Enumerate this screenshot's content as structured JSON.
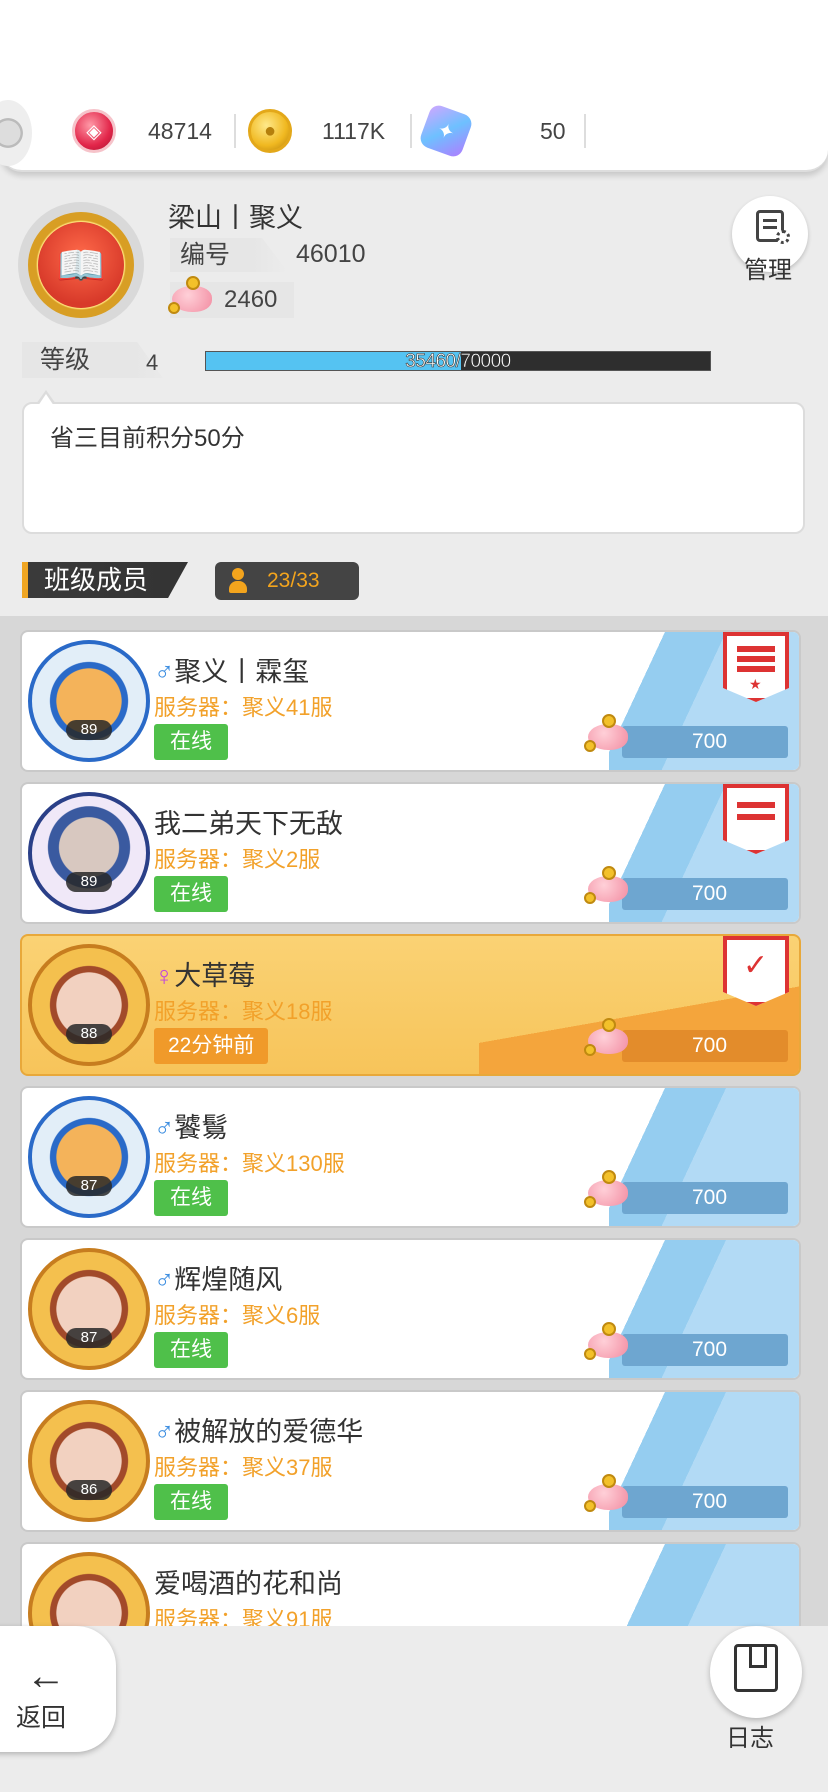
{
  "currencies": [
    {
      "icon": "ruby-icon",
      "value": "48714"
    },
    {
      "icon": "gold-coin-icon",
      "value": "1117K"
    },
    {
      "icon": "crystal-icon",
      "value": "50"
    }
  ],
  "guild": {
    "name": "梁山丨聚义",
    "id_label": "编号",
    "id_value": "46010",
    "funds": "2460",
    "level_label": "等级",
    "level": "4",
    "xp_text": "35460/70000",
    "xp_fraction": 0.5066,
    "manage_label": "管理",
    "notice": "省三目前积分50分"
  },
  "members_section": {
    "title": "班级成员",
    "count": "23/33"
  },
  "members": [
    {
      "gender": "♂",
      "name": "聚义丨霖玺",
      "server": "服务器：聚义41服",
      "level": "89",
      "status": "在线",
      "contribution": "700",
      "rank_icon": "rank-flag-leader-icon"
    },
    {
      "gender": "",
      "name": "我二弟天下无敌",
      "server": "服务器：聚义2服",
      "level": "89",
      "status": "在线",
      "contribution": "700",
      "rank_icon": "rank-flag-vice-icon"
    },
    {
      "gender": "♀",
      "name": "大草莓",
      "server": "服务器：聚义18服",
      "level": "88",
      "status": "22分钟前",
      "contribution": "700",
      "rank_icon": "rank-flag-elite-icon"
    },
    {
      "gender": "♂",
      "name": "饕鬄",
      "server": "服务器：聚义130服",
      "level": "87",
      "status": "在线",
      "contribution": "700"
    },
    {
      "gender": "♂",
      "name": "辉煌随风",
      "server": "服务器：聚义6服",
      "level": "87",
      "status": "在线",
      "contribution": "700"
    },
    {
      "gender": "♂",
      "name": "被解放的爱德华",
      "server": "服务器：聚义37服",
      "level": "86",
      "status": "在线",
      "contribution": "700"
    },
    {
      "gender": "",
      "name": "爱喝酒的花和尚",
      "server": "服务器：聚义91服",
      "level": "",
      "status": "",
      "contribution": ""
    }
  ],
  "bottom": {
    "back_label": "返回",
    "log_label": "日志"
  },
  "colors": {
    "xp_fill": "#55c3f2",
    "online_green": "#4fc04a",
    "server_orange": "#f2a12a",
    "highlight_gold": "#f7c45a"
  }
}
